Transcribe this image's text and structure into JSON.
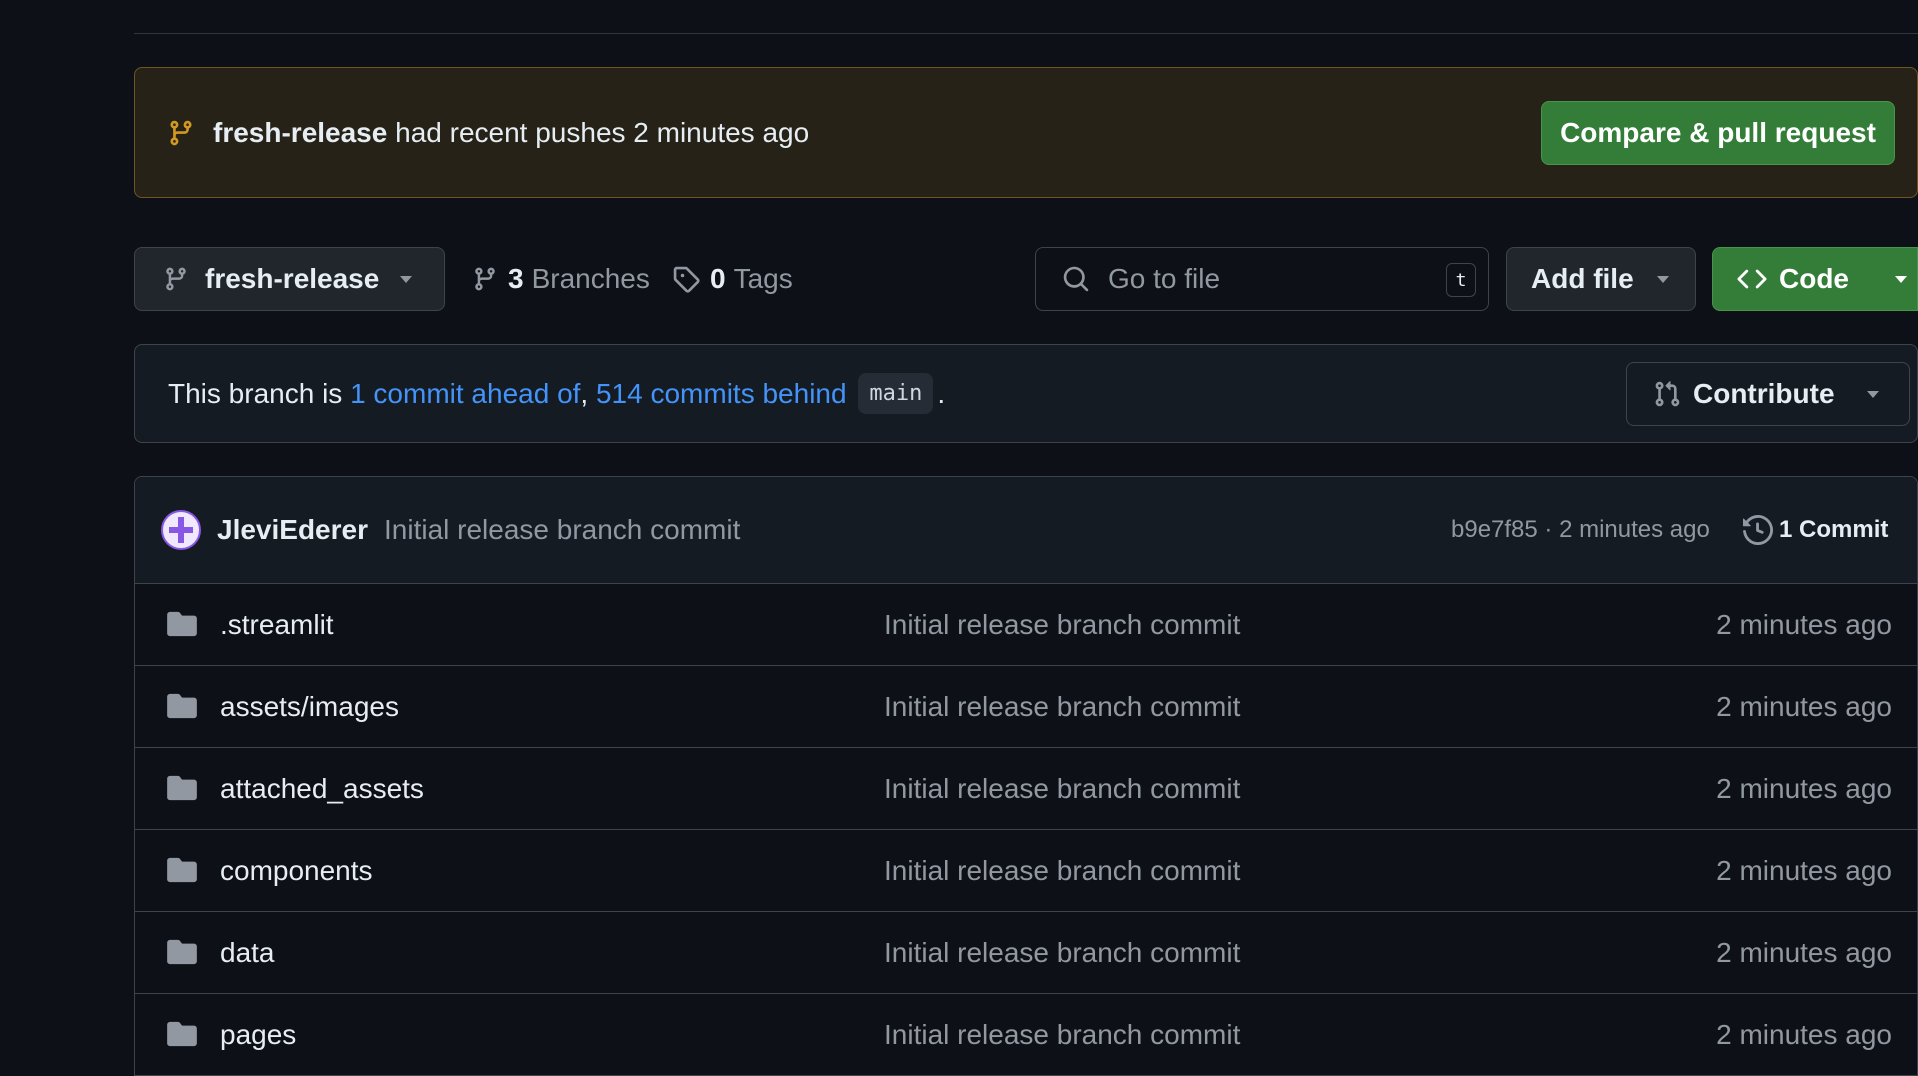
{
  "banner": {
    "branch": "fresh-release",
    "message": "had recent pushes 2 minutes ago",
    "compare_button": "Compare & pull request"
  },
  "toolbar": {
    "branch_name": "fresh-release",
    "branches_count": "3",
    "branches_label": "Branches",
    "tags_count": "0",
    "tags_label": "Tags",
    "goto_placeholder": "Go to file",
    "goto_shortcut": "t",
    "add_file_label": "Add file",
    "code_label": "Code"
  },
  "ahead_behind": {
    "prefix": "This branch is",
    "ahead_link": "1 commit ahead of",
    "separator": ",",
    "behind_link": "514 commits behind",
    "base_branch": "main",
    "suffix": ".",
    "contribute_label": "Contribute"
  },
  "latest_commit": {
    "author": "JleviEderer",
    "message": "Initial release branch commit",
    "meta": "b9e7f85 · 2 minutes ago",
    "commits_label": "1 Commit"
  },
  "files": [
    {
      "name": ".streamlit",
      "message": "Initial release branch commit",
      "age": "2 minutes ago"
    },
    {
      "name": "assets/images",
      "message": "Initial release branch commit",
      "age": "2 minutes ago"
    },
    {
      "name": "attached_assets",
      "message": "Initial release branch commit",
      "age": "2 minutes ago"
    },
    {
      "name": "components",
      "message": "Initial release branch commit",
      "age": "2 minutes ago"
    },
    {
      "name": "data",
      "message": "Initial release branch commit",
      "age": "2 minutes ago"
    },
    {
      "name": "pages",
      "message": "Initial release branch commit",
      "age": "2 minutes ago"
    }
  ],
  "colors": {
    "background": "#0d1117",
    "accent_green": "#347d39",
    "link_blue": "#4493f8",
    "banner_warning": "#d29922"
  },
  "icons": [
    "git-branch-icon",
    "caret-down-icon",
    "tag-icon",
    "search-icon",
    "code-icon",
    "git-pull-request-icon",
    "history-icon",
    "folder-icon"
  ]
}
